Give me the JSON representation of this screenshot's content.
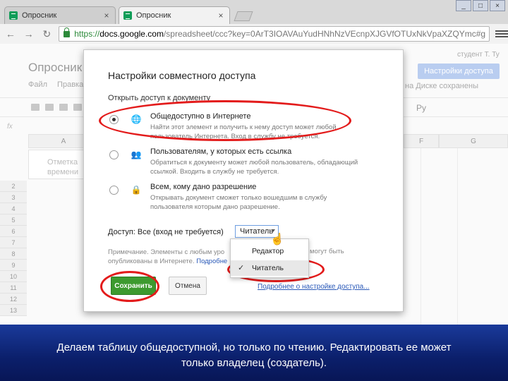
{
  "browser": {
    "tabs": [
      {
        "title": "Опросник",
        "close": "×"
      },
      {
        "title": "Опросник",
        "close": "×"
      }
    ],
    "url_scheme": "https://",
    "url_host": "docs.google.com",
    "url_rest": "/spreadsheet/ccc?key=0ArT3IOAVAuYudHNhNzVEcnpXJGVfOTUxNkVpaXZQYmc#g",
    "window_controls": [
      "_",
      "□",
      "×"
    ]
  },
  "sheet": {
    "title": "Опросник",
    "menu": [
      "Файл",
      "Правка"
    ],
    "user": "студент Т. Ту",
    "share_button": "Настройки доступа",
    "saved_status": "на Диске сохранены",
    "font_label": "Ру",
    "fx": "fx",
    "columns": [
      "A",
      "F",
      "G"
    ],
    "cell_a1": "Отметка времени",
    "rows": [
      "2",
      "3",
      "4",
      "5",
      "6",
      "7",
      "8",
      "9",
      "10",
      "11",
      "12",
      "13"
    ]
  },
  "dialog": {
    "title": "Настройки совместного доступа",
    "subtitle": "Открыть доступ к документу",
    "options": [
      {
        "title": "Общедоступно в Интернете",
        "desc": "Найти этот элемент и получить к нему доступ может любой пользователь Интернета. Вход в службу не требуется.",
        "icon": "globe-icon",
        "glyph": "🌐"
      },
      {
        "title": "Пользователям, у которых есть ссылка",
        "desc": "Обратиться к документу может любой пользователь, обладающий ссылкой. Входить в службу не требуется.",
        "icon": "link-users-icon",
        "glyph": "👥"
      },
      {
        "title": "Всем, кому дано разрешение",
        "desc": "Открывать документ сможет только вошедшим в службу пользователя которым дано разрешение.",
        "icon": "lock-icon",
        "glyph": "🔒"
      }
    ],
    "access_label": "Доступ: Все (вход не требуется)",
    "access_value": "Читатель",
    "note_text": "Примечание. Элементы с любым уро опубликованы в Интернете.",
    "note_link": "Подробне",
    "note_right": "могут быть",
    "dropdown": {
      "items": [
        "Редактор",
        "Читатель"
      ],
      "check": "✓"
    },
    "save_label": "Сохранить",
    "cancel_label": "Отмена",
    "more_link": "Подробнее о настройке доступа..."
  },
  "caption": {
    "line1": "Делаем таблицу общедоступной, но только по чтению. Редактировать ее может",
    "line2": "только владелец (создатель)."
  },
  "colors": {
    "annotation": "#e31b1b",
    "save_green": "#3d9a2f",
    "link_blue": "#2a59b8",
    "caption_bg": "#0b1f6b"
  }
}
